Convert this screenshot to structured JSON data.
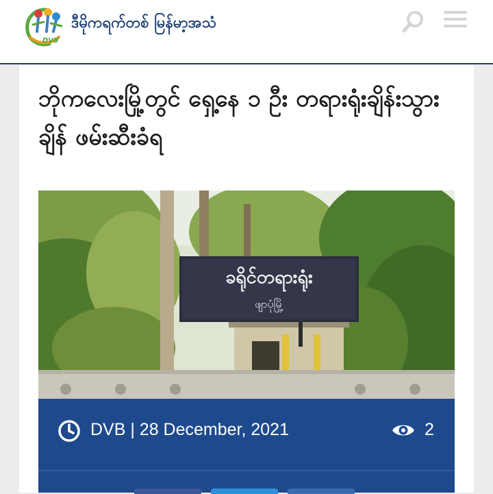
{
  "header": {
    "site_name": "ဒီမိုကရက်တစ် မြန်မာ့အသံ",
    "logo_tag": "DVB",
    "icons": {
      "search": "search-icon",
      "menu": "hamburger-menu-icon"
    }
  },
  "article": {
    "headline": "ဘိုကလေးမြို့တွင် ရှေ့နေ ၁ ဦး တရားရုံးချိန်းသွားချိန် ဖမ်းဆီးခံရ",
    "photo": {
      "sign_main": "ခရိုင်တရားရုံး",
      "sign_sub": "ဖျာပုံမြို့"
    },
    "meta": {
      "byline": "DVB | 28 December, 2021",
      "view_count": "2"
    }
  },
  "colors": {
    "brand_navy": "#1d3f73",
    "meta_bar": "#1e4a8d",
    "header_bg": "#ffffff",
    "page_bg": "#ececec"
  }
}
